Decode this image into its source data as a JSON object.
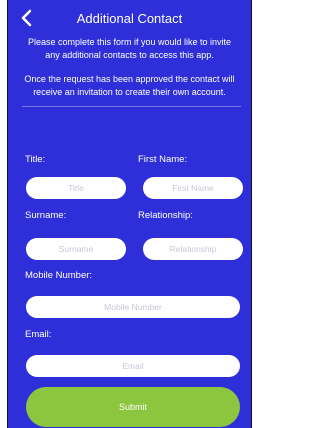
{
  "header": {
    "title": "Additional Contact"
  },
  "intro": {
    "paragraph1": "Please complete this form if you would like to invite any additional contacts to access this app.",
    "paragraph2": "Once the request has been approved the contact will receive an invitation to create their own account."
  },
  "form": {
    "title": {
      "label": "Title:",
      "placeholder": "Title",
      "value": ""
    },
    "first_name": {
      "label": "First Name:",
      "placeholder": "First Name",
      "value": ""
    },
    "surname": {
      "label": "Surname:",
      "placeholder": "Surname",
      "value": ""
    },
    "relationship": {
      "label": "Relationship:",
      "placeholder": "Relationship",
      "value": ""
    },
    "mobile_number": {
      "label": "Mobile Number:",
      "placeholder": "Mobile Number",
      "value": ""
    },
    "email": {
      "label": "Email:",
      "placeholder": "Email",
      "value": ""
    }
  },
  "submit_label": "Submit",
  "colors": {
    "background": "#2f2fd9",
    "submit": "#8cc63f",
    "field": "#ffffff",
    "placeholder": "#c8c8d8"
  },
  "icons": {
    "back": "chevron-left-icon"
  }
}
